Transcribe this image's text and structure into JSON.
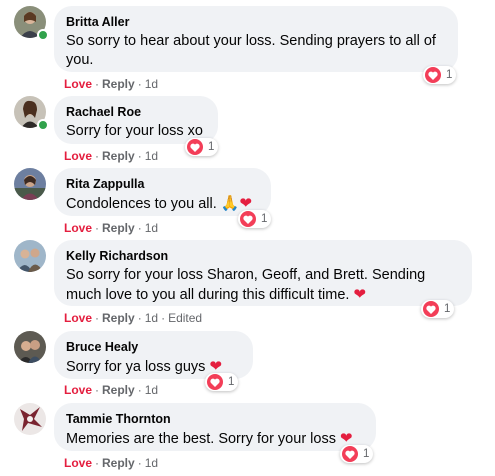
{
  "comments": [
    {
      "name": "Britta Aller",
      "text": "So sorry to hear about your loss. Sending prayers to all of you.",
      "reaction_count": "1",
      "actions": {
        "love": "Love",
        "reply": "Reply",
        "time": "1d"
      },
      "online": true
    },
    {
      "name": "Rachael Roe",
      "text": "Sorry for your loss xo",
      "reaction_count": "1",
      "actions": {
        "love": "Love",
        "reply": "Reply",
        "time": "1d"
      },
      "online": true
    },
    {
      "name": "Rita Zappulla",
      "text": "Condolences to you all.",
      "text_emoji": "🙏❤",
      "reaction_count": "1",
      "actions": {
        "love": "Love",
        "reply": "Reply",
        "time": "1d"
      },
      "online": false
    },
    {
      "name": "Kelly Richardson",
      "text": "So sorry for your loss Sharon, Geoff, and Brett. Sending much love to you all during this difficult time.",
      "text_emoji": "❤",
      "reaction_count": "1",
      "actions": {
        "love": "Love",
        "reply": "Reply",
        "time": "1d",
        "edited": "Edited"
      },
      "online": false
    },
    {
      "name": "Bruce Healy",
      "text": "Sorry for ya loss guys",
      "text_emoji": "❤",
      "reaction_count": "1",
      "actions": {
        "love": "Love",
        "reply": "Reply",
        "time": "1d"
      },
      "online": false
    },
    {
      "name": "Tammie Thornton",
      "text": "Memories are the best. Sorry for your loss",
      "text_emoji": "❤",
      "reaction_count": "1",
      "actions": {
        "love": "Love",
        "reply": "Reply",
        "time": "1d"
      },
      "online": false
    }
  ],
  "separator": "·",
  "colors": {
    "love": "#e41e3f",
    "bubble": "#f0f2f5",
    "meta": "#65676b",
    "online": "#31a24c"
  }
}
